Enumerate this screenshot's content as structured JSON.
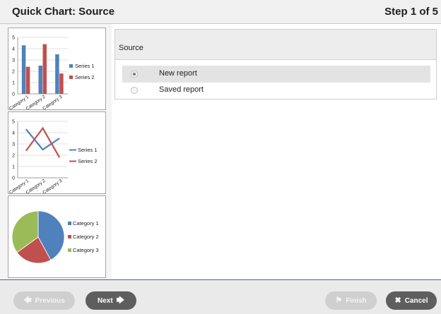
{
  "window": {
    "title": "Quick Chart: Source",
    "step": "Step 1 of 5"
  },
  "thumbnails": [
    {
      "type": "bar",
      "y_ticks": [
        "0",
        "1",
        "2",
        "3",
        "4",
        "5"
      ],
      "categories": [
        "Category 1",
        "Category 2",
        "Category 3"
      ],
      "series": [
        {
          "name": "Series 1",
          "values": [
            4.3,
            2.5,
            3.5
          ],
          "color": "#4f81bd"
        },
        {
          "name": "Series 2",
          "values": [
            2.4,
            4.4,
            1.8
          ],
          "color": "#c0504d"
        }
      ]
    },
    {
      "type": "line",
      "y_ticks": [
        "0",
        "1",
        "2",
        "3",
        "4",
        "5"
      ],
      "categories": [
        "Category 1",
        "Category 2",
        "Category 3"
      ],
      "series": [
        {
          "name": "Series 1",
          "values": [
            4.3,
            2.5,
            3.5
          ],
          "color": "#4f81bd"
        },
        {
          "name": "Series 2",
          "values": [
            2.4,
            4.4,
            1.8
          ],
          "color": "#c0504d"
        }
      ]
    },
    {
      "type": "pie",
      "slices": [
        {
          "name": "Category 1",
          "value": 42,
          "color": "#4f81bd"
        },
        {
          "name": "Category 2",
          "value": 23,
          "color": "#c0504d"
        },
        {
          "name": "Category 3",
          "value": 35,
          "color": "#9bbb59"
        }
      ]
    }
  ],
  "source": {
    "label": "Source",
    "options": [
      {
        "label": "New report",
        "selected": true
      },
      {
        "label": "Saved report",
        "selected": false
      }
    ]
  },
  "footer": {
    "previous_label": "Previous",
    "next_label": "Next",
    "finish_label": "Finish",
    "cancel_label": "Cancel"
  }
}
